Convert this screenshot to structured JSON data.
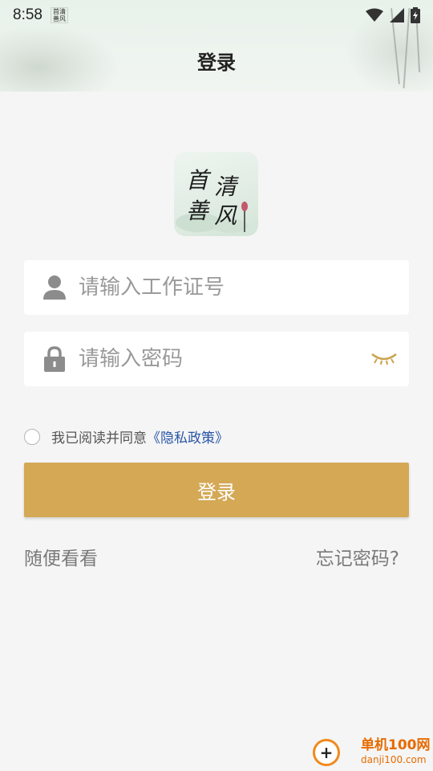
{
  "status_bar": {
    "time": "8:58",
    "app_icon_text": "首清善风"
  },
  "header": {
    "title": "登录"
  },
  "logo": {
    "chars": [
      "首",
      "清",
      "善",
      "风"
    ]
  },
  "form": {
    "employee_id": {
      "placeholder": "请输入工作证号",
      "value": ""
    },
    "password": {
      "placeholder": "请输入密码",
      "value": ""
    }
  },
  "agreement": {
    "text": "我已阅读并同意",
    "link": "《隐私政策》",
    "checked": false
  },
  "buttons": {
    "login": "登录",
    "guest": "随便看看",
    "forgot": "忘记密码?"
  },
  "watermark": {
    "name": "单机100网",
    "url": "danji100.com"
  },
  "colors": {
    "accent": "#d4a855",
    "link": "#2a56a6",
    "eye_icon": "#c9a24a"
  }
}
